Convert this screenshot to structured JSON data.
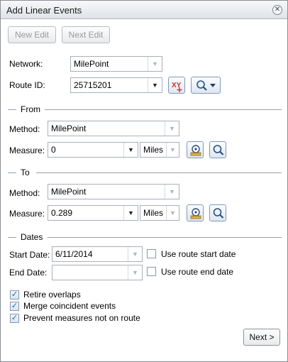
{
  "window": {
    "title": "Add Linear Events",
    "close_icon": "close-icon"
  },
  "toolbar": {
    "new_edit_label": "New Edit",
    "next_edit_label": "Next Edit"
  },
  "network": {
    "label": "Network:",
    "value": "MilePoint"
  },
  "route": {
    "label": "Route ID:",
    "value": "25715201"
  },
  "from": {
    "section_label": "From",
    "method_label": "Method:",
    "method_value": "MilePoint",
    "measure_label": "Measure:",
    "measure_value": "0",
    "units_value": "Miles"
  },
  "to": {
    "section_label": "To",
    "method_label": "Method:",
    "method_value": "MilePoint",
    "measure_label": "Measure:",
    "measure_value": "0.289",
    "units_value": "Miles"
  },
  "dates": {
    "section_label": "Dates",
    "start_label": "Start Date:",
    "start_value": "6/11/2014",
    "start_checkbox_label": "Use route start date",
    "end_label": "End Date:",
    "end_value": "",
    "end_checkbox_label": "Use route end date"
  },
  "options": [
    {
      "label": "Retire overlaps",
      "checked": true
    },
    {
      "label": "Merge coincident events",
      "checked": true
    },
    {
      "label": "Prevent measures not on route",
      "checked": true
    }
  ],
  "footer": {
    "next_label": "Next >"
  },
  "colors": {
    "accent": "#2f5d9b",
    "xy_red": "#d22a2a"
  }
}
